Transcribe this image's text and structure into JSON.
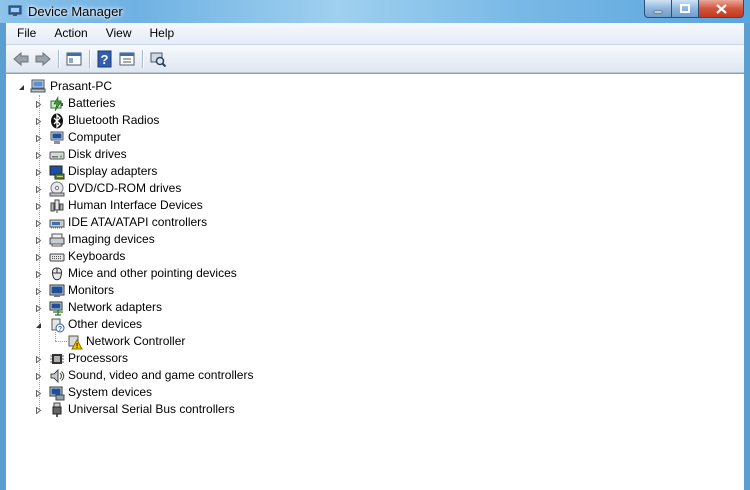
{
  "window": {
    "title": "Device Manager"
  },
  "menu": [
    "File",
    "Action",
    "View",
    "Help"
  ],
  "toolbar": [
    "back-icon",
    "forward-icon",
    "show-hide-console-tree-icon",
    "help-icon",
    "properties-icon",
    "scan-hardware-icon"
  ],
  "tree": {
    "root": {
      "label": "Prasant-PC",
      "icon": "computer-root-icon",
      "expanded": true
    },
    "categories": [
      {
        "label": "Batteries",
        "icon": "battery-icon"
      },
      {
        "label": "Bluetooth Radios",
        "icon": "bluetooth-icon"
      },
      {
        "label": "Computer",
        "icon": "computer-icon"
      },
      {
        "label": "Disk drives",
        "icon": "disk-drive-icon"
      },
      {
        "label": "Display adapters",
        "icon": "display-adapter-icon"
      },
      {
        "label": "DVD/CD-ROM drives",
        "icon": "dvd-drive-icon"
      },
      {
        "label": "Human Interface Devices",
        "icon": "hid-icon"
      },
      {
        "label": "IDE ATA/ATAPI controllers",
        "icon": "ide-controller-icon"
      },
      {
        "label": "Imaging devices",
        "icon": "imaging-device-icon"
      },
      {
        "label": "Keyboards",
        "icon": "keyboard-icon"
      },
      {
        "label": "Mice and other pointing devices",
        "icon": "mouse-icon"
      },
      {
        "label": "Monitors",
        "icon": "monitor-icon"
      },
      {
        "label": "Network adapters",
        "icon": "network-adapter-icon"
      },
      {
        "label": "Other devices",
        "icon": "other-devices-icon",
        "expanded": true,
        "children": [
          {
            "label": "Network Controller",
            "icon": "warning-device-icon"
          }
        ]
      },
      {
        "label": "Processors",
        "icon": "processor-icon"
      },
      {
        "label": "Sound, video and game controllers",
        "icon": "sound-icon"
      },
      {
        "label": "System devices",
        "icon": "system-devices-icon"
      },
      {
        "label": "Universal Serial Bus controllers",
        "icon": "usb-icon"
      }
    ]
  },
  "colors": {
    "titlebar": "#6fb1e3",
    "close": "#c4381f",
    "warning": "#f5c400"
  }
}
